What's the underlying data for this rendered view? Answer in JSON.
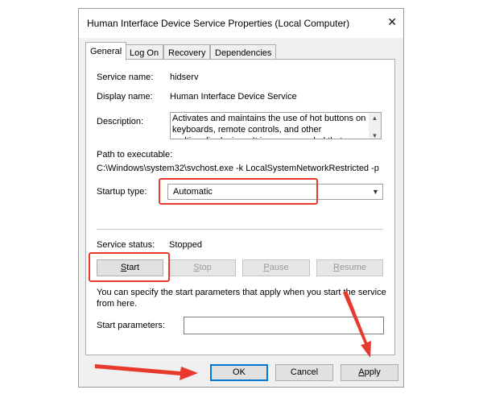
{
  "window": {
    "title": "Human Interface Device Service Properties (Local Computer)",
    "close_glyph": "✕"
  },
  "tabs": [
    {
      "label": "General",
      "active": true
    },
    {
      "label": "Log On",
      "active": false
    },
    {
      "label": "Recovery",
      "active": false
    },
    {
      "label": "Dependencies",
      "active": false
    }
  ],
  "general": {
    "service_name_label": "Service name:",
    "service_name_value": "hidserv",
    "display_name_label": "Display name:",
    "display_name_value": "Human Interface Device Service",
    "description_label": "Description:",
    "description_value": "Activates and maintains the use of hot buttons on keyboards, remote controls, and other multimedia devices. It is recommended that you keep this",
    "path_label": "Path to executable:",
    "path_value": "C:\\Windows\\system32\\svchost.exe -k LocalSystemNetworkRestricted -p",
    "startup_type_label": "Startup type:",
    "startup_type_value": "Automatic",
    "service_status_label": "Service status:",
    "service_status_value": "Stopped",
    "buttons": {
      "start": "Start",
      "stop": "Stop",
      "pause": "Pause",
      "resume": "Resume"
    },
    "params_help": "You can specify the start parameters that apply when you start the service from here.",
    "start_params_label": "Start parameters:",
    "start_params_value": ""
  },
  "footer": {
    "ok": "OK",
    "cancel": "Cancel",
    "apply": "Apply"
  },
  "colors": {
    "annotation": "#e8392f",
    "focus": "#0078d7"
  }
}
